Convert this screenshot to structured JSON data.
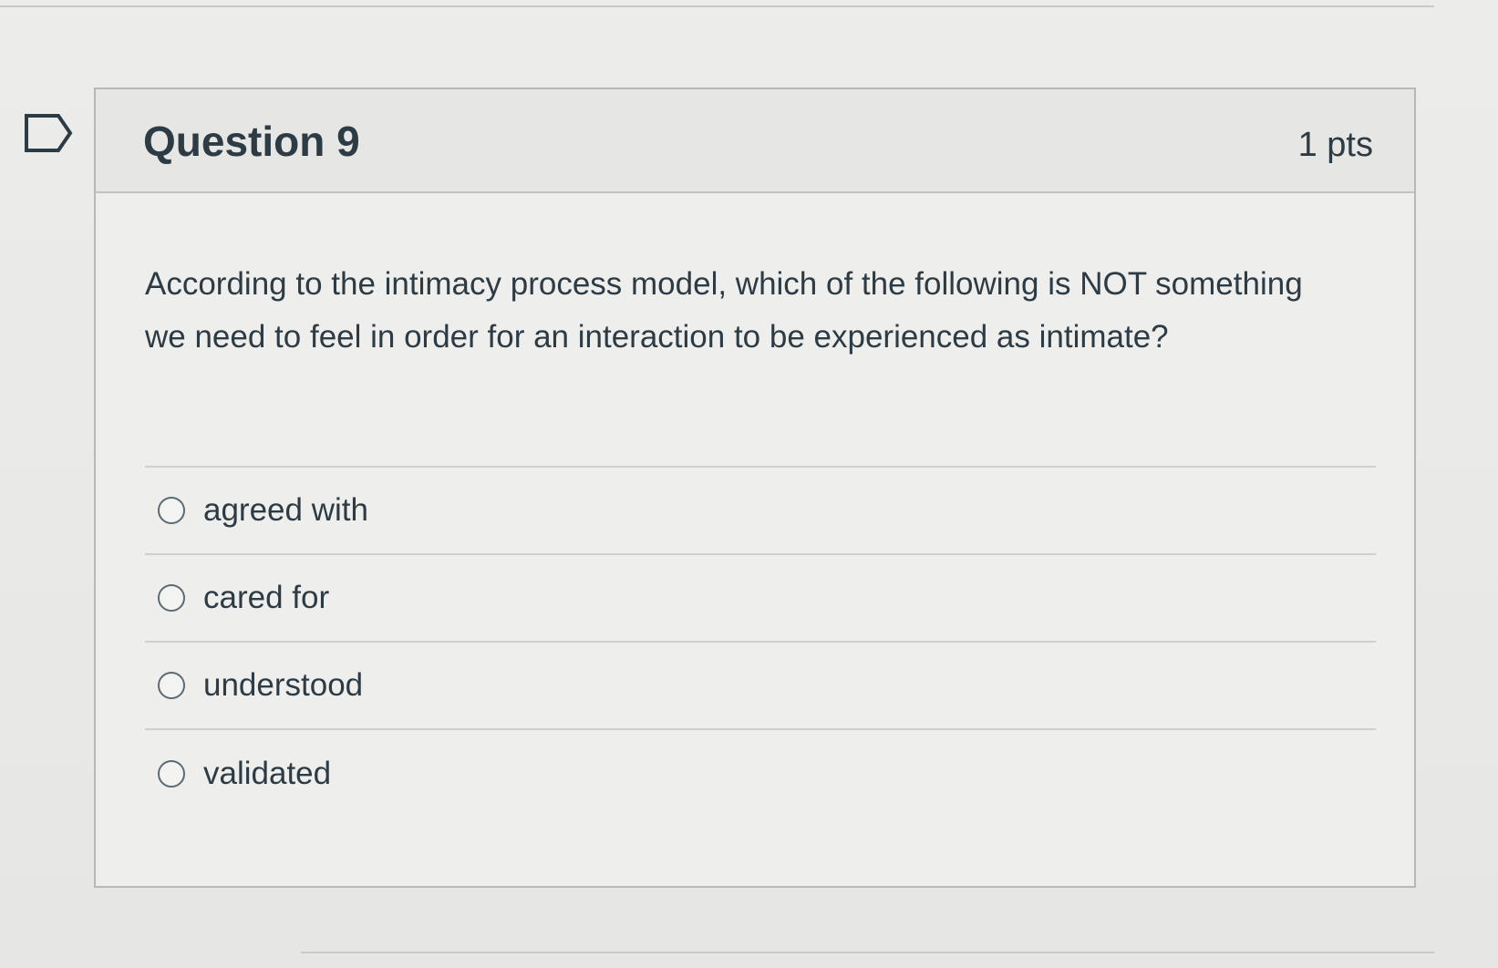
{
  "question": {
    "title": "Question 9",
    "points": "1 pts",
    "text": "According to the intimacy process model, which of the following is NOT something we need to feel in order for an interaction to be experienced as intimate?",
    "answers": [
      {
        "label": "agreed with",
        "selected": false
      },
      {
        "label": "cared for",
        "selected": false
      },
      {
        "label": "understood",
        "selected": false
      },
      {
        "label": "validated",
        "selected": false
      }
    ]
  },
  "icons": {
    "flag": "flag-question-icon"
  }
}
